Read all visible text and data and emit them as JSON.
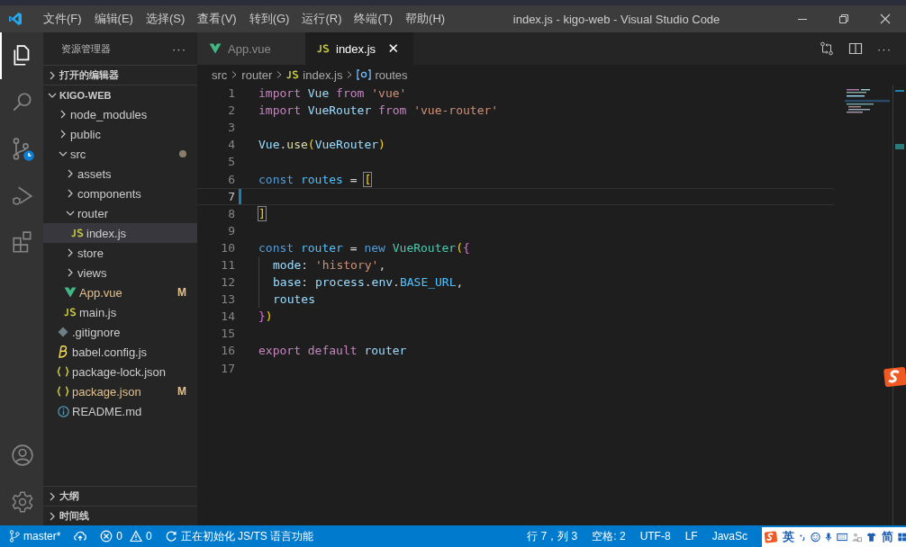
{
  "window": {
    "title": "index.js - kigo-web - Visual Studio Code"
  },
  "menu": [
    "文件(F)",
    "编辑(E)",
    "选择(S)",
    "查看(V)",
    "转到(G)",
    "运行(R)",
    "终端(T)",
    "帮助(H)"
  ],
  "activity_bar": [
    {
      "kind": "explorer",
      "selected": true
    },
    {
      "kind": "search",
      "selected": false
    },
    {
      "kind": "scm",
      "selected": false
    },
    {
      "kind": "debug",
      "selected": false
    },
    {
      "kind": "extensions",
      "selected": false
    }
  ],
  "sidebar": {
    "title": "资源管理器",
    "more": "···",
    "sections": [
      {
        "label": "打开的编辑器",
        "expanded": false
      }
    ],
    "tree": {
      "label": "KIGO-WEB",
      "expanded": true,
      "items": [
        {
          "name": "node_modules",
          "kind": "folder",
          "expanded": false,
          "selected": false
        },
        {
          "name": "public",
          "kind": "folder",
          "expanded": false,
          "selected": false
        },
        {
          "name": "src",
          "kind": "folder",
          "expanded": true,
          "selected": false,
          "modified_dot": true,
          "children": [
            {
              "name": "assets",
              "kind": "folder",
              "expanded": false,
              "selected": false
            },
            {
              "name": "components",
              "kind": "folder",
              "expanded": false,
              "selected": false
            },
            {
              "name": "router",
              "kind": "folder",
              "expanded": true,
              "selected": false,
              "children": [
                {
                  "name": "index.js",
                  "kind": "js",
                  "selected": true
                }
              ]
            },
            {
              "name": "store",
              "kind": "folder",
              "expanded": false,
              "selected": false
            },
            {
              "name": "views",
              "kind": "folder",
              "expanded": false,
              "selected": false
            },
            {
              "name": "App.vue",
              "kind": "vue",
              "selected": false,
              "badge": "M"
            },
            {
              "name": "main.js",
              "kind": "js",
              "selected": false
            }
          ]
        },
        {
          "name": ".gitignore",
          "kind": "git",
          "selected": false
        },
        {
          "name": "babel.config.js",
          "kind": "babel",
          "selected": false
        },
        {
          "name": "package-lock.json",
          "kind": "json",
          "selected": false
        },
        {
          "name": "package.json",
          "kind": "json",
          "selected": false,
          "badge": "M"
        },
        {
          "name": "README.md",
          "kind": "info",
          "selected": false
        }
      ]
    },
    "bottom_sections": [
      {
        "label": "大纲",
        "expanded": false
      },
      {
        "label": "时间线",
        "expanded": false
      }
    ]
  },
  "tabs": [
    {
      "label": "App.vue",
      "kind": "vue",
      "selected": false
    },
    {
      "label": "index.js",
      "kind": "js",
      "selected": true,
      "close": "✕"
    }
  ],
  "breadcrumb": [
    {
      "label": "src",
      "kind": "folder"
    },
    {
      "label": "router",
      "kind": "folder"
    },
    {
      "label": "index.js",
      "kind": "js"
    },
    {
      "label": "routes",
      "kind": "symbol"
    }
  ],
  "editor": {
    "lines": [
      {
        "number": "1",
        "current": false,
        "tokens": [
          {
            "text": "import ",
            "kind": "keyword"
          },
          {
            "text": "Vue ",
            "kind": "variable"
          },
          {
            "text": "from ",
            "kind": "keyword"
          },
          {
            "text": "'vue'",
            "kind": "string"
          }
        ]
      },
      {
        "number": "2",
        "current": false,
        "tokens": [
          {
            "text": "import ",
            "kind": "keyword"
          },
          {
            "text": "VueRouter ",
            "kind": "variable"
          },
          {
            "text": "from ",
            "kind": "keyword"
          },
          {
            "text": "'vue-router'",
            "kind": "string"
          }
        ]
      },
      {
        "number": "3",
        "current": false
      },
      {
        "number": "4",
        "current": false,
        "tokens": [
          {
            "text": "Vue",
            "kind": "variable"
          },
          {
            "text": ".",
            "kind": "plain"
          },
          {
            "text": "use",
            "kind": "function"
          },
          {
            "text": "(",
            "kind": "bracket"
          },
          {
            "text": "VueRouter",
            "kind": "variable"
          },
          {
            "text": ")",
            "kind": "bracket"
          }
        ]
      },
      {
        "number": "5",
        "current": false
      },
      {
        "number": "6",
        "current": false,
        "tokens": [
          {
            "text": "const ",
            "kind": "storage"
          },
          {
            "text": "routes ",
            "kind": "constant"
          },
          {
            "text": "= ",
            "kind": "plain"
          },
          {
            "text": "[",
            "kind": "bracket-match"
          }
        ]
      },
      {
        "number": "7",
        "current": true
      },
      {
        "number": "8",
        "current": false,
        "tokens": [
          {
            "text": "]",
            "kind": "bracket-match"
          }
        ]
      },
      {
        "number": "9",
        "current": false
      },
      {
        "number": "10",
        "current": false,
        "tokens": [
          {
            "text": "const ",
            "kind": "storage"
          },
          {
            "text": "router ",
            "kind": "constant"
          },
          {
            "text": "= ",
            "kind": "plain"
          },
          {
            "text": "new ",
            "kind": "storage"
          },
          {
            "text": "VueRouter",
            "kind": "class"
          },
          {
            "text": "(",
            "kind": "bracket"
          },
          {
            "text": "{",
            "kind": "bracket2"
          }
        ]
      },
      {
        "number": "11",
        "current": false,
        "indent": true,
        "tokens": [
          {
            "text": "mode",
            "kind": "variable"
          },
          {
            "text": ": ",
            "kind": "plain"
          },
          {
            "text": "'history'",
            "kind": "string"
          },
          {
            "text": ",",
            "kind": "plain"
          }
        ]
      },
      {
        "number": "12",
        "current": false,
        "indent": true,
        "tokens": [
          {
            "text": "base",
            "kind": "variable"
          },
          {
            "text": ": ",
            "kind": "plain"
          },
          {
            "text": "process",
            "kind": "variable"
          },
          {
            "text": ".",
            "kind": "plain"
          },
          {
            "text": "env",
            "kind": "variable"
          },
          {
            "text": ".",
            "kind": "plain"
          },
          {
            "text": "BASE_URL",
            "kind": "constant"
          },
          {
            "text": ",",
            "kind": "plain"
          }
        ]
      },
      {
        "number": "13",
        "current": false,
        "indent": true,
        "tokens": [
          {
            "text": "routes",
            "kind": "variable"
          }
        ]
      },
      {
        "number": "14",
        "current": false,
        "tokens": [
          {
            "text": "}",
            "kind": "bracket2"
          },
          {
            "text": ")",
            "kind": "bracket"
          }
        ]
      },
      {
        "number": "15",
        "current": false
      },
      {
        "number": "16",
        "current": false,
        "tokens": [
          {
            "text": "export ",
            "kind": "keyword"
          },
          {
            "text": "default ",
            "kind": "keyword"
          },
          {
            "text": "router",
            "kind": "variable"
          }
        ]
      },
      {
        "number": "17",
        "current": false
      }
    ]
  },
  "status_bar": {
    "branch": "master*",
    "errors": "0",
    "warnings": "0",
    "progress": "正在初始化 JS/TS 语言功能",
    "right": [
      "行 7，列 3",
      "空格: 2",
      "UTF-8",
      "LF",
      "JavaSc"
    ]
  },
  "ime_toolbar": {
    "mode": "英",
    "script": "简"
  }
}
